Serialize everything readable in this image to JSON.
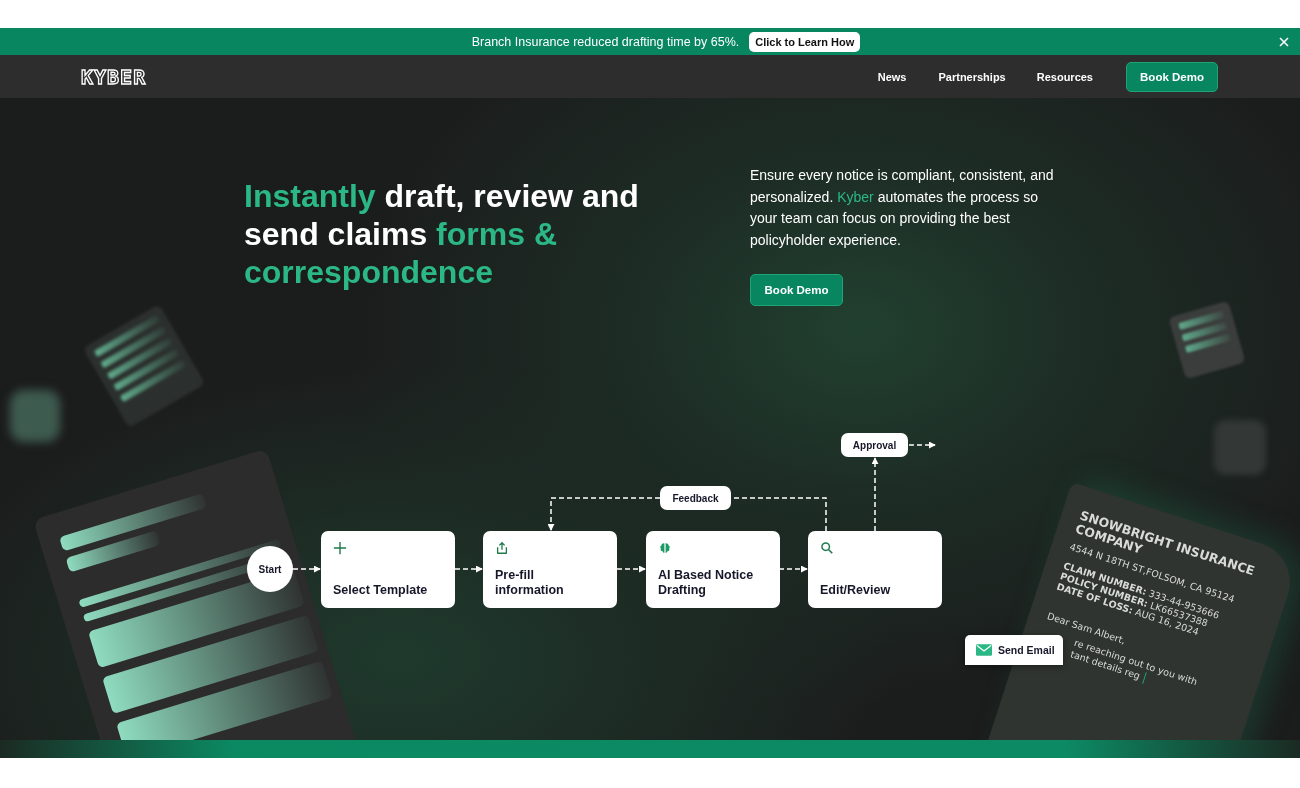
{
  "announcement": {
    "text": "Branch Insurance reduced drafting time by 65%.",
    "link": "Click to Learn How"
  },
  "nav": {
    "logo": "KYBER",
    "links": [
      "News",
      "Partnerships",
      "Resources"
    ],
    "cta": "Book Demo"
  },
  "hero": {
    "headline": [
      {
        "text": "Instantly",
        "accent": true
      },
      {
        "text": " draft, review and send claims ",
        "accent": false
      },
      {
        "text": "forms & correspondence",
        "accent": true
      }
    ],
    "description": [
      {
        "text": "Ensure every notice is compliant, consistent, and personalized. ",
        "accent": false
      },
      {
        "text": "Kyber",
        "accent": true
      },
      {
        "text": " automates the process so your team can focus on providing the best policyholder experience.",
        "accent": false
      }
    ],
    "cta": "Book Demo"
  },
  "flow": {
    "start": "Start",
    "steps": [
      {
        "kind": "plus",
        "label": "Select Template"
      },
      {
        "kind": "share",
        "label": "Pre-fill information"
      },
      {
        "kind": "brain",
        "label": "AI Based Notice Drafting"
      },
      {
        "kind": "search",
        "label": "Edit/Review"
      }
    ],
    "feedback": "Feedback",
    "approval": "Approval"
  },
  "letter": {
    "company": "SNOWBRIGHT INSURANCE COMPANY",
    "address": "4544 N 18TH ST,FOLSOM, CA 95124",
    "details": [
      "**CLAIM NUMBER:** 333-44-953666",
      "**POLICY NUMBER:** LK66537388",
      "**DATE OF LOSS:** AUG 16, 2024"
    ],
    "greeting": "Dear Sam Albert,",
    "body": [
      "re reaching out to you with",
      "tant details reg"
    ]
  },
  "send_email": {
    "label": "Send Email"
  }
}
